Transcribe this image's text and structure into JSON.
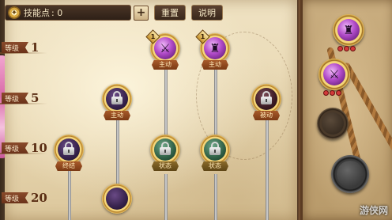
{
  "top_bar": {
    "skill_points_label": "技能点",
    "skill_points_value": ": 0",
    "plus_label": "+",
    "reset_label": "重置",
    "help_label": "说明"
  },
  "levels": [
    {
      "tag": "等级",
      "num": "1"
    },
    {
      "tag": "等级",
      "num": "5"
    },
    {
      "tag": "等级",
      "num": "10"
    },
    {
      "tag": "等级",
      "num": "20"
    }
  ],
  "skills": [
    {
      "id": "active-1",
      "banner": "主动",
      "rank": "1",
      "state": "unlocked"
    },
    {
      "id": "active-2",
      "banner": "主动",
      "rank": "1",
      "state": "unlocked"
    },
    {
      "id": "active-3",
      "banner": "主动",
      "state": "locked"
    },
    {
      "id": "passive-1",
      "banner": "被动",
      "state": "locked"
    },
    {
      "id": "ultimate-1",
      "banner": "终结",
      "state": "locked"
    },
    {
      "id": "status-1",
      "banner": "状态",
      "state": "locked"
    },
    {
      "id": "status-2",
      "banner": "状态",
      "state": "locked"
    }
  ],
  "equip_slots": [
    {
      "state": "equipped"
    },
    {
      "state": "equipped"
    },
    {
      "state": "empty"
    },
    {
      "state": "empty"
    }
  ],
  "watermark": "游侠网",
  "colors": {
    "parchment": "#e9d9b4",
    "level_tag": "#7a3d1e",
    "ring_gold": "#e8c063",
    "active_purple": "#b04ac8",
    "locked_green": "#2f5e44",
    "rank_dot": "#d23a3a"
  }
}
